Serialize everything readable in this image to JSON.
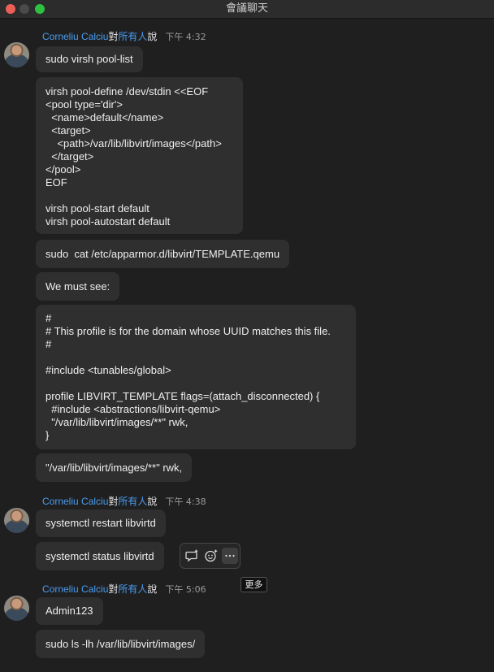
{
  "window": {
    "title": "會議聊天"
  },
  "groups": [
    {
      "sender": "Corneliu Calciu",
      "to_word": "對",
      "recipient": "所有人",
      "says": "說",
      "time": "下午 4:32",
      "messages": [
        "sudo virsh pool-list",
        "virsh pool-define /dev/stdin <<EOF\n<pool type='dir'>\n  <name>default</name>\n  <target>\n    <path>/var/lib/libvirt/images</path>\n  </target>\n</pool>\nEOF\n\nvirsh pool-start default\nvirsh pool-autostart default",
        "sudo  cat /etc/apparmor.d/libvirt/TEMPLATE.qemu",
        "We must see:",
        "#\n# This profile is for the domain whose UUID matches this file.\n#\n\n#include <tunables/global>\n\nprofile LIBVIRT_TEMPLATE flags=(attach_disconnected) {\n  #include <abstractions/libvirt-qemu>\n  \"/var/lib/libvirt/images/**\" rwk,\n}",
        "\"/var/lib/libvirt/images/**\" rwk,"
      ]
    },
    {
      "sender": "Corneliu Calciu",
      "to_word": "對",
      "recipient": "所有人",
      "says": "說",
      "time": "下午 4:38",
      "messages": [
        "systemctl restart libvirtd",
        "systemctl status libvirtd"
      ]
    },
    {
      "sender": "Corneliu Calciu",
      "to_word": "對",
      "recipient": "所有人",
      "says": "說",
      "time": "下午 5:06",
      "messages": [
        "Admin123",
        "sudo ls -lh /var/lib/libvirt/images/"
      ]
    }
  ],
  "toolbar": {
    "icons": [
      "reply-thread-icon",
      "add-reaction-icon",
      "more-options-icon"
    ],
    "tooltip": "更多"
  }
}
